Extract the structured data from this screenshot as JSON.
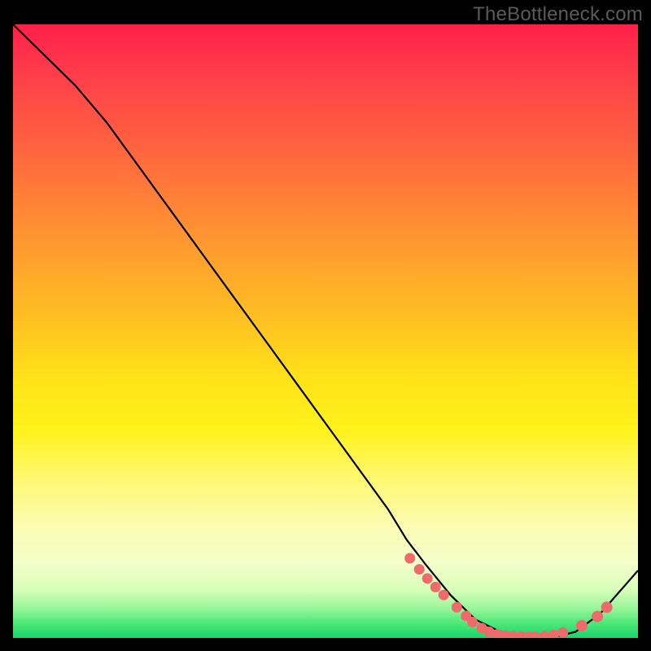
{
  "watermark": "TheBottleneck.com",
  "chart_data": {
    "type": "line",
    "title": "",
    "xlabel": "",
    "ylabel": "",
    "xlim": [
      0,
      100
    ],
    "ylim": [
      0,
      100
    ],
    "curve": {
      "x": [
        0,
        6,
        10,
        15,
        20,
        25,
        30,
        35,
        40,
        45,
        50,
        55,
        60,
        63,
        66,
        70,
        74,
        78,
        82,
        86,
        90,
        94,
        100
      ],
      "y": [
        100,
        94,
        90,
        84,
        77,
        70,
        63,
        56,
        49,
        42,
        35,
        28,
        21,
        16,
        12,
        7,
        3,
        1,
        0,
        0,
        1,
        4,
        11
      ]
    },
    "marker_cluster_a": {
      "x": [
        63.5,
        65.0,
        66.3,
        67.6,
        68.9,
        71.0,
        72.5,
        73.5,
        75.0,
        76.2,
        77.5,
        78.8,
        80.0,
        81.3,
        82.5,
        83.5,
        85.0,
        86.5,
        88.0
      ],
      "y": [
        13.0,
        11.2,
        9.7,
        8.3,
        7.0,
        5.0,
        3.6,
        2.6,
        1.6,
        1.0,
        0.6,
        0.4,
        0.3,
        0.25,
        0.2,
        0.2,
        0.3,
        0.5,
        0.9
      ]
    },
    "marker_cluster_b": {
      "x": [
        91.0,
        93.5,
        95.0
      ],
      "y": [
        2.0,
        3.5,
        5.0
      ]
    },
    "colors": {
      "gradient_top": "#ff1f4a",
      "gradient_mid": "#ffe318",
      "gradient_bottom": "#17d46a",
      "curve": "#000000",
      "markers": "#ef6b6b",
      "frame": "#000000"
    }
  }
}
